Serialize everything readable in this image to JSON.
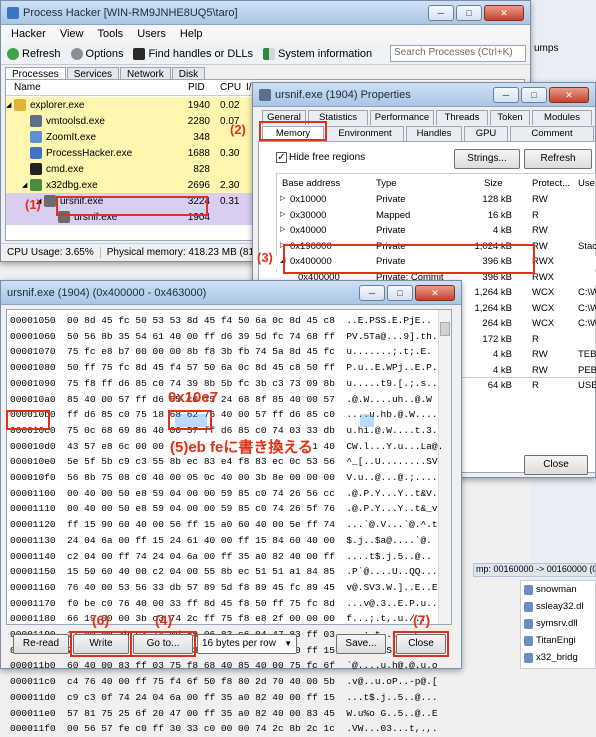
{
  "ph": {
    "title": "Process Hacker [WIN-RM9JNHE8UQ5\\taro]",
    "menu": [
      "Hacker",
      "View",
      "Tools",
      "Users",
      "Help"
    ],
    "toolbar": {
      "refresh": "Refresh",
      "options": "Options",
      "find": "Find handles or DLLs",
      "sysinfo": "System information"
    },
    "search_placeholder": "Search Processes (Ctrl+K)",
    "tabs": [
      "Processes",
      "Services",
      "Network",
      "Disk"
    ],
    "cols": {
      "name": "Name",
      "pid": "PID",
      "cpu": "CPU",
      "io": "I/O"
    },
    "rows": [
      {
        "name": "explorer.exe",
        "pid": "1940",
        "cpu": "0.02"
      },
      {
        "name": "vmtoolsd.exe",
        "pid": "2280",
        "cpu": "0.07"
      },
      {
        "name": "ZoomIt.exe",
        "pid": "348",
        "cpu": ""
      },
      {
        "name": "ProcessHacker.exe",
        "pid": "1688",
        "cpu": "0.30"
      },
      {
        "name": "cmd.exe",
        "pid": "828",
        "cpu": ""
      },
      {
        "name": "x32dbg.exe",
        "pid": "2696",
        "cpu": "2.30"
      },
      {
        "name": "ursnif.exe",
        "pid": "3224",
        "cpu": "0.31"
      },
      {
        "name": "ursnif.exe",
        "pid": "1904",
        "cpu": ""
      }
    ],
    "status": {
      "cpu": "CPU Usage: 3.65%",
      "mem": "Physical memory: 418.23 MB (81.77%)",
      "procs": "Pr"
    }
  },
  "props": {
    "title": "ursnif.exe (1904) Properties",
    "tabs_row1": [
      "General",
      "Statistics",
      "Performance",
      "Threads",
      "Token",
      "Modules"
    ],
    "tabs_row2": [
      "Memory",
      "Environment",
      "Handles",
      "GPU",
      "Comment"
    ],
    "hide_free": "Hide free regions",
    "strings_btn": "Strings...",
    "refresh_btn": "Refresh",
    "cols": {
      "base": "Base address",
      "type": "Type",
      "size": "Size",
      "prot": "Protect...",
      "use": "Use"
    },
    "rows": [
      {
        "base": "0x10000",
        "type": "Private",
        "size": "128 kB",
        "prot": "RW",
        "use": ""
      },
      {
        "base": "0x30000",
        "type": "Mapped",
        "size": "16 kB",
        "prot": "R",
        "use": ""
      },
      {
        "base": "0x40000",
        "type": "Private",
        "size": "4 kB",
        "prot": "RW",
        "use": ""
      },
      {
        "base": "0x190000",
        "type": "Private",
        "size": "1,024 kB",
        "prot": "RW",
        "use": "Stack"
      },
      {
        "base": "0x400000",
        "type": "Private",
        "size": "396 kB",
        "prot": "RWX",
        "use": ""
      },
      {
        "base": "0x400000",
        "type": "Private: Commit",
        "size": "396 kB",
        "prot": "RWX",
        "use": ""
      },
      {
        "base": "",
        "type": "",
        "size": "1,264 kB",
        "prot": "WCX",
        "use": "C:\\Wi"
      },
      {
        "base": "",
        "type": "",
        "size": "1,264 kB",
        "prot": "WCX",
        "use": "C:\\Wi"
      },
      {
        "base": "",
        "type": "",
        "size": "264 kB",
        "prot": "WCX",
        "use": "C:\\Wi"
      },
      {
        "base": "",
        "type": "",
        "size": "172 kB",
        "prot": "R",
        "use": ""
      },
      {
        "base": "",
        "type": "",
        "size": "4 kB",
        "prot": "RW",
        "use": "TEB (("
      },
      {
        "base": "",
        "type": "",
        "size": "4 kB",
        "prot": "RW",
        "use": "PEB"
      },
      {
        "base": "",
        "type": "",
        "size": "64 kB",
        "prot": "R",
        "use": "USER"
      }
    ],
    "close_btn": "Close"
  },
  "hexwin": {
    "title": "ursnif.exe (1904) (0x400000 - 0x463000)",
    "lines": [
      "00001050  00 8d 45 fc 50 53 53 8d 45 f4 50 6a 0c 8d 45 c8  ..E.PSS.E.PjE..",
      "00001060  50 56 8b 35 54 61 40 00 ff d6 39 5d fc 74 68 ff  PV.5Ta@...9].th.",
      "00001070  75 fc e8 b7 00 00 00 8b f8 3b fb 74 5a 8d 45 fc  u.......;.t;.E.",
      "00001080  50 ff 75 fc 8d 45 f4 57 50 6a 0c 8d 45 c8 50 ff  P.u..E.WPj..E.P.",
      "00001090  75 f8 ff d6 85 c0 74 39 8b 5b fc 3b c3 73 09 8b  u.....t9.[.;.s..",
      "000010a0  85 40 00 57 ff d6 85 c0 75 24 68 8f 85 40 00 57  .@.W....uh..@.W",
      "000010b0  ff d6 85 c0 75 18 68 62 76 40 00 57 ff d6 85 c0  ....u.hb.@.W....",
      "000010c0  75 0c 68 69 86 40 00 57 ff d6 85 c0 74 03 33 db  u.hi.@.W....t.3.",
      "000010d0  43 57 e8 6c 00 00 00 59 ff 75 f8 ff 15 4c 61 40  CW.l...Y.u...La@.",
      "000010e0  5e 5f 5b c9 c3 55 8b ec 83 e4 f8 83 ec 0c 53 56  ^_[..U........SV",
      "000010f0  56 8b 75 08 c0 40 00 05 0c 40 00 3b 8e 00 00 00  V.u..@...@.;....",
      "00001100  00 40 00 50 e8 59 04 00 00 59 85 c0 74 26 56 cc  .@.P.Y...Y..t&V.",
      "00001110  00 40 00 50 e8 59 04 00 00 59 85 c0 74 26 5f 76  .@.P.Y...Y..t&_v",
      "00001120  ff 15 90 60 40 00 56 ff 15 a0 60 40 00 5e ff 74  ...`@.V...`@.^.t",
      "00001130  24 04 6a 00 ff 15 24 61 40 00 ff 15 84 60 40 00  $.j..$a@....`@.",
      "00001140  c2 04 00 ff 74 24 04 6a 00 ff 35 a0 82 40 00 ff  ....t$.j.5..@..",
      "00001150  15 50 60 40 00 c2 04 00 55 8b ec 51 51 a1 84 85  .P`@....U..QQ...",
      "00001160  76 40 00 53 56 33 db 57 89 5d f8 89 45 fc 89 45  v@.SV3.W.]..E..E",
      "00001170  f0 be c0 76 40 00 33 ff 8d 45 f8 50 ff 75 fc 8d  ...v@.3..E.P.u..",
      "00001180  66 19 00 00 3b c3 74 2c ff 75 f8 e8 2f 00 00 00  f...;.t,.u./...",
      "00001190  17 00 00 3b c3 74 0d 89 06 83 c6 04 47 83 ff 03  ...;.t......G...",
      "000011a0  72 d6 eb 1f ff 75 f8 53 ff 35 a0 82 40 00 ff 15  r....u.S.5..@...",
      "000011b0  60 40 00 83 ff 03 75 f8 68 40 85 40 00 75 fc 6f  `@....u.h@.@.u.o",
      "000011c0  c4 76 40 00 ff 75 f4 6f 50 f8 80 2d 70 40 00 5b  .v@..u.oP..-p@.[",
      "000011d0  c9 c3 0f 74 24 04 6a 00 ff 35 a0 82 40 00 ff 15  ...t$.j..5..@...",
      "000011e0  57 81 75 25 6f 20 47 00 ff 35 a0 82 40 00 83 45  W.u%o G..5..@..E",
      "000011f0  00 56 57 fe c0 ff 30 33 c0 00 00 74 2c 8b 2c 1c  .VW...03...t,.,."
    ],
    "buttons": {
      "reread": "Re-read",
      "write": "Write",
      "goto": "Go to...",
      "bytes": "16 bytes per row",
      "save": "Save...",
      "close": "Close"
    }
  },
  "right": {
    "items": [
      "snowman",
      "ssleay32.dl",
      "symsrv.dll",
      "TitanEngi",
      "x32_bridg"
    ],
    "dump": "mp: 00160000 -> 00160000 (0x0",
    "ps": "umps",
    "bar": "TX"
  },
  "annotations": {
    "a1": "(1)",
    "a2": "(2)",
    "a3": "(3)",
    "a4": "(4)",
    "a5": "(5)eb feに書き換える",
    "a6": "(6)",
    "a7": "(7)",
    "addr": "0x10e7"
  },
  "highlight": {
    "addr_label": "000010e0",
    "bytes": "56 33"
  }
}
